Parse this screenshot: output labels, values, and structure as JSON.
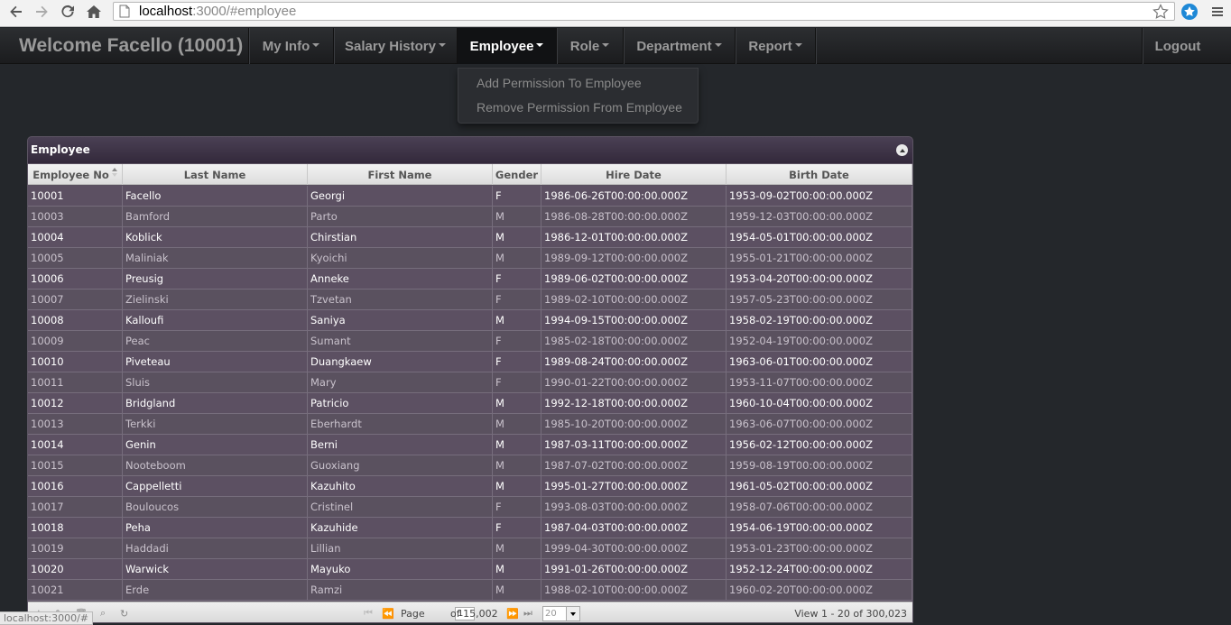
{
  "browser": {
    "url_host": "localhost",
    "url_rest": ":3000/#employee",
    "status_url": "localhost:3000/#"
  },
  "navbar": {
    "brand": "Welcome Facello (10001)",
    "items": [
      {
        "label": "My Info",
        "active": false
      },
      {
        "label": "Salary History",
        "active": false
      },
      {
        "label": "Employee",
        "active": true
      },
      {
        "label": "Role",
        "active": false
      },
      {
        "label": "Department",
        "active": false
      },
      {
        "label": "Report",
        "active": false
      }
    ],
    "logout": "Logout"
  },
  "dropdown": {
    "items": [
      "Add Permission To Employee",
      "Remove Permission From Employee"
    ]
  },
  "grid": {
    "title": "Employee",
    "columns": [
      "Employee No",
      "Last Name",
      "First Name",
      "Gender",
      "Hire Date",
      "Birth Date"
    ],
    "rows": [
      [
        "10001",
        "Facello",
        "Georgi",
        "F",
        "1986-06-26T00:00:00.000Z",
        "1953-09-02T00:00:00.000Z"
      ],
      [
        "10003",
        "Bamford",
        "Parto",
        "M",
        "1986-08-28T00:00:00.000Z",
        "1959-12-03T00:00:00.000Z"
      ],
      [
        "10004",
        "Koblick",
        "Chirstian",
        "M",
        "1986-12-01T00:00:00.000Z",
        "1954-05-01T00:00:00.000Z"
      ],
      [
        "10005",
        "Maliniak",
        "Kyoichi",
        "M",
        "1989-09-12T00:00:00.000Z",
        "1955-01-21T00:00:00.000Z"
      ],
      [
        "10006",
        "Preusig",
        "Anneke",
        "F",
        "1989-06-02T00:00:00.000Z",
        "1953-04-20T00:00:00.000Z"
      ],
      [
        "10007",
        "Zielinski",
        "Tzvetan",
        "F",
        "1989-02-10T00:00:00.000Z",
        "1957-05-23T00:00:00.000Z"
      ],
      [
        "10008",
        "Kalloufi",
        "Saniya",
        "M",
        "1994-09-15T00:00:00.000Z",
        "1958-02-19T00:00:00.000Z"
      ],
      [
        "10009",
        "Peac",
        "Sumant",
        "F",
        "1985-02-18T00:00:00.000Z",
        "1952-04-19T00:00:00.000Z"
      ],
      [
        "10010",
        "Piveteau",
        "Duangkaew",
        "F",
        "1989-08-24T00:00:00.000Z",
        "1963-06-01T00:00:00.000Z"
      ],
      [
        "10011",
        "Sluis",
        "Mary",
        "F",
        "1990-01-22T00:00:00.000Z",
        "1953-11-07T00:00:00.000Z"
      ],
      [
        "10012",
        "Bridgland",
        "Patricio",
        "M",
        "1992-12-18T00:00:00.000Z",
        "1960-10-04T00:00:00.000Z"
      ],
      [
        "10013",
        "Terkki",
        "Eberhardt",
        "M",
        "1985-10-20T00:00:00.000Z",
        "1963-06-07T00:00:00.000Z"
      ],
      [
        "10014",
        "Genin",
        "Berni",
        "M",
        "1987-03-11T00:00:00.000Z",
        "1956-02-12T00:00:00.000Z"
      ],
      [
        "10015",
        "Nooteboom",
        "Guoxiang",
        "M",
        "1987-07-02T00:00:00.000Z",
        "1959-08-19T00:00:00.000Z"
      ],
      [
        "10016",
        "Cappelletti",
        "Kazuhito",
        "M",
        "1995-01-27T00:00:00.000Z",
        "1961-05-02T00:00:00.000Z"
      ],
      [
        "10017",
        "Bouloucos",
        "Cristinel",
        "F",
        "1993-08-03T00:00:00.000Z",
        "1958-07-06T00:00:00.000Z"
      ],
      [
        "10018",
        "Peha",
        "Kazuhide",
        "F",
        "1987-04-03T00:00:00.000Z",
        "1954-06-19T00:00:00.000Z"
      ],
      [
        "10019",
        "Haddadi",
        "Lillian",
        "M",
        "1999-04-30T00:00:00.000Z",
        "1953-01-23T00:00:00.000Z"
      ],
      [
        "10020",
        "Warwick",
        "Mayuko",
        "M",
        "1991-01-26T00:00:00.000Z",
        "1952-12-24T00:00:00.000Z"
      ],
      [
        "10021",
        "Erde",
        "Ramzi",
        "M",
        "1988-02-10T00:00:00.000Z",
        "1960-02-20T00:00:00.000Z"
      ]
    ]
  },
  "pager": {
    "page_label": "Page",
    "page_value": "1",
    "of_label": "of 15,002",
    "page_size": "20",
    "view_info": "View 1 - 20 of 300,023"
  },
  "icons": {
    "back": "back-arrow-icon",
    "forward": "forward-arrow-icon",
    "reload": "reload-icon",
    "home": "home-icon",
    "bookmark": "star-icon",
    "extension": "extension-icon",
    "menu": "hamburger-menu-icon"
  }
}
